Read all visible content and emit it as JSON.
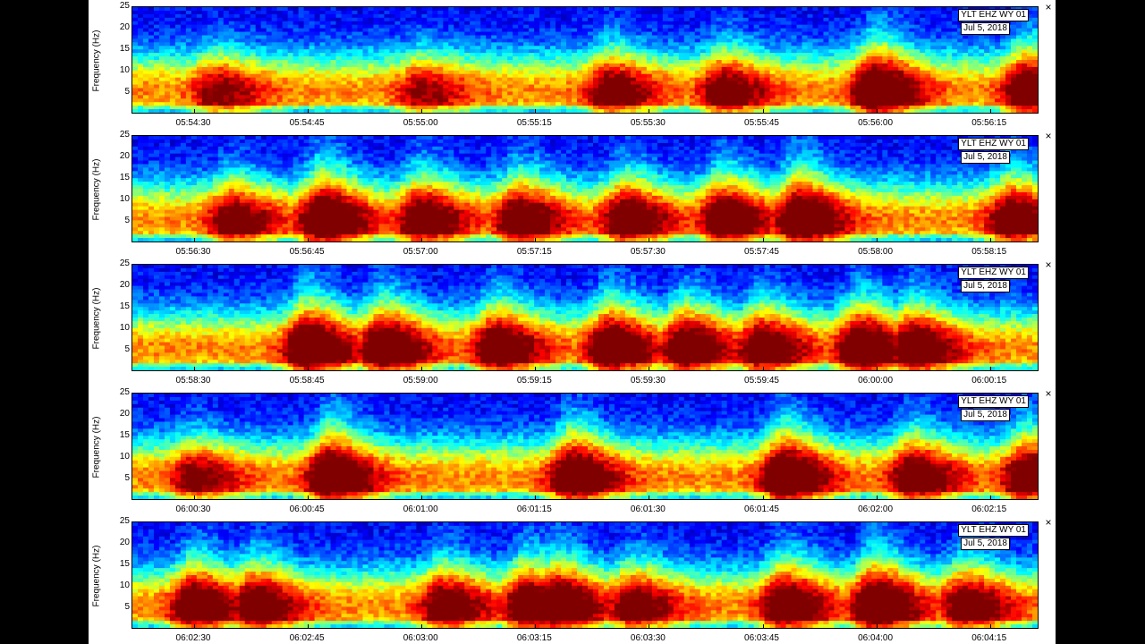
{
  "panels": [
    {
      "station": "YLT EHZ WY 01",
      "date": "Jul 5, 2018",
      "ylabel": "Frequency (Hz)",
      "yticks": [
        "25",
        "20",
        "15",
        "10",
        "5"
      ],
      "xticks": [
        "05:54:30",
        "05:54:45",
        "05:55:00",
        "05:55:15",
        "05:55:30",
        "05:55:45",
        "05:56:00",
        "05:56:15"
      ]
    },
    {
      "station": "YLT EHZ WY 01",
      "date": "Jul 5, 2018",
      "ylabel": "Frequency (Hz)",
      "yticks": [
        "25",
        "20",
        "15",
        "10",
        "5"
      ],
      "xticks": [
        "05:56:30",
        "05:56:45",
        "05:57:00",
        "05:57:15",
        "05:57:30",
        "05:57:45",
        "05:58:00",
        "05:58:15"
      ]
    },
    {
      "station": "YLT EHZ WY 01",
      "date": "Jul 5, 2018",
      "ylabel": "Frequency (Hz)",
      "yticks": [
        "25",
        "20",
        "15",
        "10",
        "5"
      ],
      "xticks": [
        "05:58:30",
        "05:58:45",
        "05:59:00",
        "05:59:15",
        "05:59:30",
        "05:59:45",
        "06:00:00",
        "06:00:15"
      ]
    },
    {
      "station": "YLT EHZ WY 01",
      "date": "Jul 5, 2018",
      "ylabel": "Frequency (Hz)",
      "yticks": [
        "25",
        "20",
        "15",
        "10",
        "5"
      ],
      "xticks": [
        "06:00:30",
        "06:00:45",
        "06:01:00",
        "06:01:15",
        "06:01:30",
        "06:01:45",
        "06:02:00",
        "06:02:15"
      ]
    },
    {
      "station": "YLT EHZ WY 01",
      "date": "Jul 5, 2018",
      "ylabel": "Frequency (Hz)",
      "yticks": [
        "25",
        "20",
        "15",
        "10",
        "5"
      ],
      "xticks": [
        "06:02:30",
        "06:02:45",
        "06:03:00",
        "06:03:15",
        "06:03:30",
        "06:03:45",
        "06:04:00",
        "06:04:15"
      ]
    }
  ],
  "chart_data": [
    {
      "type": "heatmap",
      "ylabel": "Frequency (Hz)",
      "ylim": [
        0,
        25
      ],
      "x_ticks": [
        "05:54:30",
        "05:54:45",
        "05:55:00",
        "05:55:15",
        "05:55:30",
        "05:55:45",
        "05:56:00",
        "05:56:15"
      ],
      "y_ticks": [
        5,
        10,
        15,
        20,
        25
      ],
      "colormap": "jet",
      "burst_peaks_hhmmss": [
        "05:54:33",
        "05:55:00",
        "05:55:25",
        "05:55:40",
        "05:56:00",
        "05:56:20"
      ],
      "burst_intensity": [
        0.55,
        0.5,
        0.7,
        0.7,
        0.95,
        0.85
      ]
    },
    {
      "type": "heatmap",
      "ylabel": "Frequency (Hz)",
      "ylim": [
        0,
        25
      ],
      "x_ticks": [
        "05:56:30",
        "05:56:45",
        "05:57:00",
        "05:57:15",
        "05:57:30",
        "05:57:45",
        "05:58:00",
        "05:58:15"
      ],
      "y_ticks": [
        5,
        10,
        15,
        20,
        25
      ],
      "colormap": "jet",
      "burst_peaks_hhmmss": [
        "05:56:35",
        "05:56:47",
        "05:57:00",
        "05:57:13",
        "05:57:27",
        "05:57:40",
        "05:57:50",
        "05:58:18"
      ],
      "burst_intensity": [
        0.7,
        0.95,
        0.8,
        0.8,
        0.8,
        0.85,
        0.95,
        0.8
      ]
    },
    {
      "type": "heatmap",
      "ylabel": "Frequency (Hz)",
      "ylim": [
        0,
        25
      ],
      "x_ticks": [
        "05:58:30",
        "05:58:45",
        "05:59:00",
        "05:59:15",
        "05:59:30",
        "05:59:45",
        "06:00:00",
        "06:00:15"
      ],
      "y_ticks": [
        5,
        10,
        15,
        20,
        25
      ],
      "colormap": "jet",
      "burst_peaks_hhmmss": [
        "05:58:45",
        "05:58:55",
        "05:59:10",
        "05:59:25",
        "05:59:35",
        "05:59:45",
        "05:59:58",
        "06:00:05"
      ],
      "burst_intensity": [
        0.95,
        0.9,
        0.85,
        0.9,
        0.85,
        0.8,
        0.9,
        0.85
      ]
    },
    {
      "type": "heatmap",
      "ylabel": "Frequency (Hz)",
      "ylim": [
        0,
        25
      ],
      "x_ticks": [
        "06:00:30",
        "06:00:45",
        "06:01:00",
        "06:01:15",
        "06:01:30",
        "06:01:45",
        "06:02:00",
        "06:02:15"
      ],
      "y_ticks": [
        5,
        10,
        15,
        20,
        25
      ],
      "colormap": "jet",
      "burst_peaks_hhmmss": [
        "06:00:30",
        "06:00:48",
        "06:01:20",
        "06:01:48",
        "06:02:05",
        "06:02:20"
      ],
      "burst_intensity": [
        0.6,
        0.95,
        0.9,
        0.95,
        0.8,
        0.85
      ]
    },
    {
      "type": "heatmap",
      "ylabel": "Frequency (Hz)",
      "ylim": [
        0,
        25
      ],
      "x_ticks": [
        "06:02:30",
        "06:02:45",
        "06:03:00",
        "06:03:15",
        "06:03:30",
        "06:03:45",
        "06:04:00",
        "06:04:15"
      ],
      "y_ticks": [
        5,
        10,
        15,
        20,
        25
      ],
      "colormap": "jet",
      "burst_peaks_hhmmss": [
        "06:02:30",
        "06:02:38",
        "06:03:03",
        "06:03:14",
        "06:03:18",
        "06:03:28",
        "06:03:48",
        "06:04:00",
        "06:04:12"
      ],
      "burst_intensity": [
        0.85,
        0.8,
        0.75,
        0.85,
        0.9,
        0.7,
        0.85,
        0.95,
        0.75
      ]
    }
  ]
}
